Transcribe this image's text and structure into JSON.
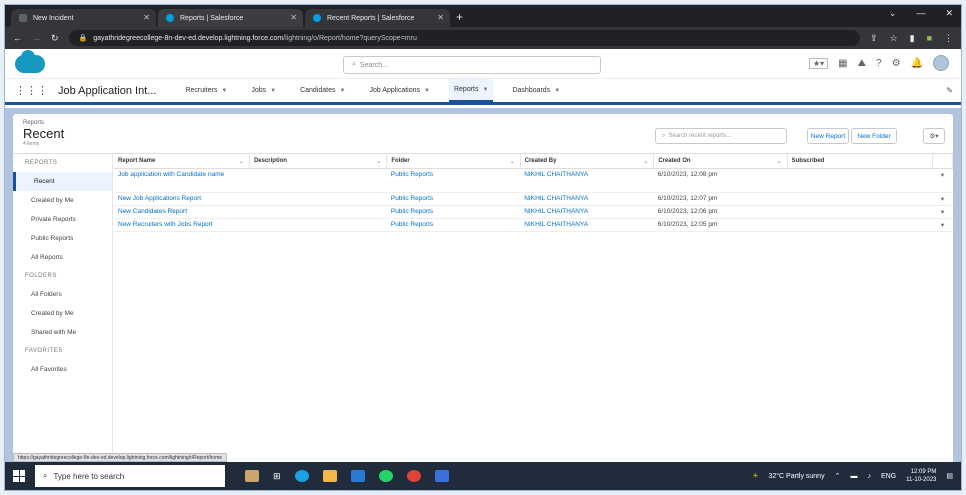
{
  "browser": {
    "tabs": [
      {
        "label": "New Incident",
        "icon_color": "#5f6368",
        "active": false
      },
      {
        "label": "Reports | Salesforce",
        "icon_color": "#00a1e0",
        "active": true
      },
      {
        "label": "Recent Reports | Salesforce",
        "icon_color": "#00a1e0",
        "active": false
      }
    ],
    "url_host": "gayathridegreecollege-8n-dev-ed.develop.lightning.force.com",
    "url_path": "/lightning/o/Report/home?queryScope=mru"
  },
  "header": {
    "search_placeholder": "Search..."
  },
  "nav": {
    "app_name": "Job Application Int...",
    "items": [
      {
        "label": "Recruiters",
        "active": false
      },
      {
        "label": "Jobs",
        "active": false
      },
      {
        "label": "Candidates",
        "active": false
      },
      {
        "label": "Job Applications",
        "active": false
      },
      {
        "label": "Reports",
        "active": true
      },
      {
        "label": "Dashboards",
        "active": false
      }
    ]
  },
  "page": {
    "breadcrumb": "Reports",
    "title": "Recent",
    "count": "4 items",
    "search_placeholder": "Search recent reports...",
    "new_report": "New Report",
    "new_folder": "New Folder"
  },
  "sidebar": {
    "reports_header": "REPORTS",
    "reports": [
      "Recent",
      "Created by Me",
      "Private Reports",
      "Public Reports",
      "All Reports"
    ],
    "folders_header": "FOLDERS",
    "folders": [
      "All Folders",
      "Created by Me",
      "Shared with Me"
    ],
    "favorites_header": "FAVORITES",
    "favorites": [
      "All Favorites"
    ]
  },
  "table": {
    "columns": [
      "Report Name",
      "Description",
      "Folder",
      "Created By",
      "Created On",
      "Subscribed"
    ],
    "rows": [
      {
        "name": "Job application with Candidate name",
        "description": "",
        "folder": "Public Reports",
        "created_by": "NIKHIL CHAITHANYA",
        "created_on": "6/10/2023, 12:08 pm"
      },
      {
        "name": "New Job Applications Report",
        "description": "",
        "folder": "Public Reports",
        "created_by": "NIKHIL CHAITHANYA",
        "created_on": "6/10/2023, 12:07 pm"
      },
      {
        "name": "New Candidates Report",
        "description": "",
        "folder": "Public Reports",
        "created_by": "NIKHIL CHAITHANYA",
        "created_on": "6/10/2023, 12:06 pm"
      },
      {
        "name": "New Recruiters with Jobs Report",
        "description": "",
        "folder": "Public Reports",
        "created_by": "NIKHIL CHAITHANYA",
        "created_on": "6/10/2023, 12:05 pm"
      }
    ]
  },
  "statusbar": {
    "text": "https://gayathridegreecollege-8n-dev-ed.develop.lightning.force.com/lightning/r/Report/home"
  },
  "taskbar": {
    "search_placeholder": "Type here to search",
    "weather": "32°C Partly sunny",
    "lang": "ENG",
    "time": "12:09 PM",
    "date": "11-10-2023"
  },
  "colors": {
    "brand": "#1798c1",
    "nav_accent": "#1b5297",
    "link": "#0070d2",
    "page_bg": "#b0c4df"
  }
}
